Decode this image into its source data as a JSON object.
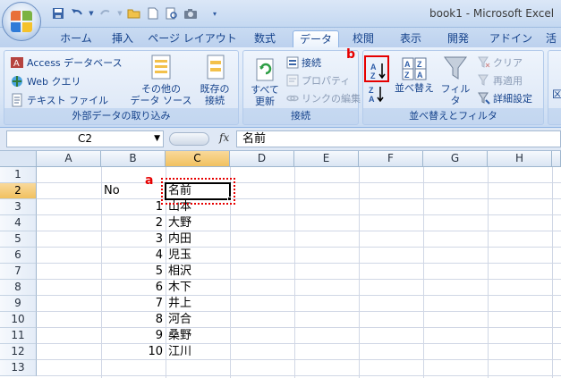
{
  "window": {
    "title": "book1 - Microsoft Excel"
  },
  "tabs": [
    {
      "label": "ホーム",
      "active": false
    },
    {
      "label": "挿入",
      "active": false
    },
    {
      "label": "ページ レイアウト",
      "active": false
    },
    {
      "label": "数式",
      "active": false
    },
    {
      "label": "データ",
      "active": true
    },
    {
      "label": "校閲",
      "active": false
    },
    {
      "label": "表示",
      "active": false
    },
    {
      "label": "開発",
      "active": false
    },
    {
      "label": "アドイン",
      "active": false
    },
    {
      "label": "活",
      "active": false
    }
  ],
  "ribbon": {
    "external_data": {
      "label": "外部データの取り込み",
      "access": "Access データベース",
      "web": "Web クエリ",
      "text": "テキスト ファイル",
      "other_line1": "その他の",
      "other_line2": "データ ソース",
      "existing_line1": "既存の",
      "existing_line2": "接続"
    },
    "connections": {
      "label": "接続",
      "refresh_line1": "すべて",
      "refresh_line2": "更新",
      "connections": "接続",
      "properties": "プロパティ",
      "edit_links": "リンクの編集"
    },
    "sort_filter": {
      "label": "並べ替えとフィルタ",
      "sort": "並べ替え",
      "filter": "フィルタ",
      "clear": "クリア",
      "reapply": "再適用",
      "advanced": "詳細設定"
    },
    "partial_next": "区"
  },
  "annotations": {
    "a": "a",
    "b": "b"
  },
  "accent_colors": {
    "annotation": "#e60000",
    "selected_header": "#f1c15f"
  },
  "formula_bar": {
    "name_box": "C2",
    "fx": "fx",
    "value": "名前"
  },
  "sheet": {
    "columns": [
      "A",
      "B",
      "C",
      "D",
      "E",
      "F",
      "G",
      "H"
    ],
    "selected_column": "C",
    "selected_row": "2",
    "rows": [
      {
        "num": "1",
        "b": "",
        "c": ""
      },
      {
        "num": "2",
        "b": "No",
        "c": "名前"
      },
      {
        "num": "3",
        "b": "1",
        "c": "山本"
      },
      {
        "num": "4",
        "b": "2",
        "c": "大野"
      },
      {
        "num": "5",
        "b": "3",
        "c": "内田"
      },
      {
        "num": "6",
        "b": "4",
        "c": "児玉"
      },
      {
        "num": "7",
        "b": "5",
        "c": "相沢"
      },
      {
        "num": "8",
        "b": "6",
        "c": "木下"
      },
      {
        "num": "9",
        "b": "7",
        "c": "井上"
      },
      {
        "num": "10",
        "b": "8",
        "c": "河合"
      },
      {
        "num": "11",
        "b": "9",
        "c": "桑野"
      },
      {
        "num": "12",
        "b": "10",
        "c": "江川"
      },
      {
        "num": "13",
        "b": "",
        "c": ""
      }
    ]
  }
}
